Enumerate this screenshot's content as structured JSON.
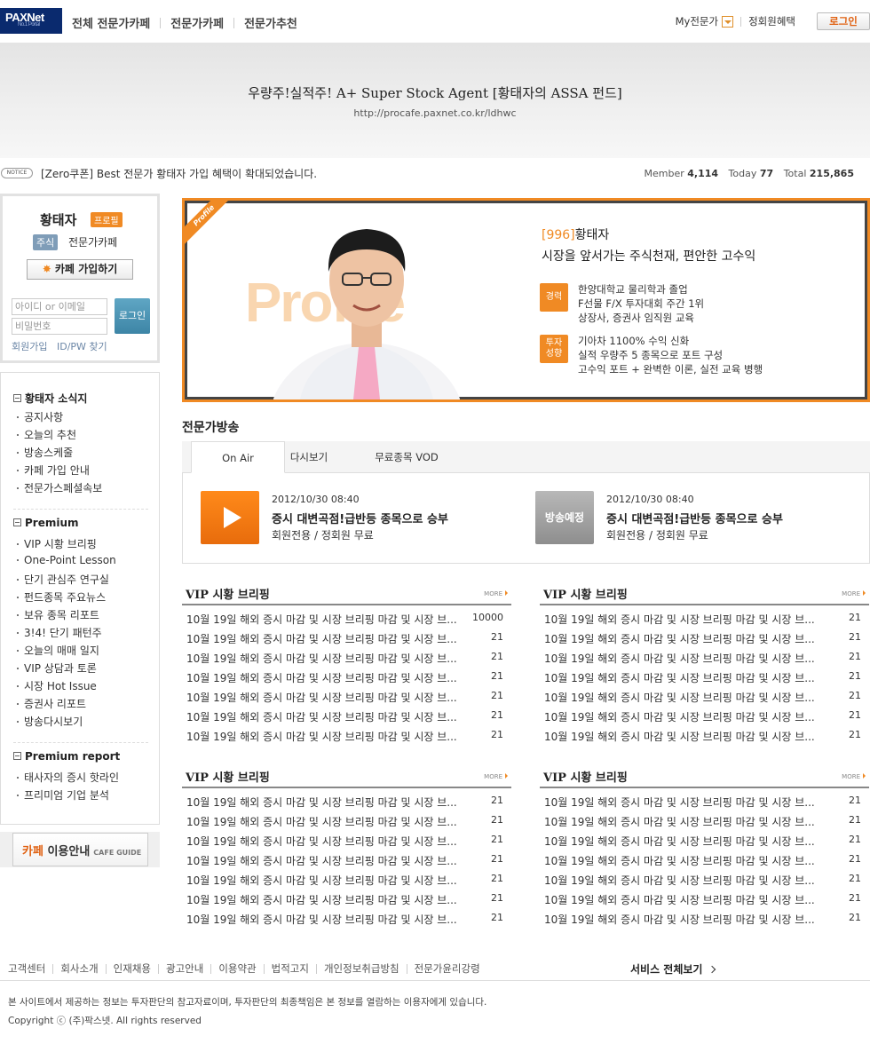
{
  "header": {
    "logo": "PAXNet",
    "logo_sub": "No.1 Portal",
    "nav": [
      "전체 전문가카페",
      "전문가카페",
      "전문가추천"
    ],
    "my_expert": "My전문가",
    "member_benefit": "정회원혜택",
    "login": "로그인"
  },
  "banner": {
    "title": "우량주!실적주! A+ Super Stock Agent [황태자의 ASSA 펀드]",
    "url": "http://procafe.paxnet.co.kr/ldhwc"
  },
  "notice": {
    "badge": "NOTICE",
    "text": "[Zero쿠폰] Best 전문가 황태자 가입 혜택이 확대되었습니다.",
    "member_label": "Member",
    "member": "4,114",
    "today_label": "Today",
    "today": "77",
    "total_label": "Total",
    "total": "215,865"
  },
  "sidebar": {
    "name": "황태자",
    "profile_tag": "프로필",
    "category": "주식",
    "cafe_type": "전문가카페",
    "join": "카페 가입하기",
    "id_placeholder": "아이디 or 이메일",
    "pw_placeholder": "비밀번호",
    "login": "로그인",
    "signup": "회원가입",
    "find": "ID/PW 찾기",
    "sections": [
      {
        "title": "황태자 소식지",
        "items": [
          "공지사항",
          "오늘의 추천",
          "방송스케줄",
          "카페 가입 안내",
          "전문가스페셜속보"
        ]
      },
      {
        "title": "Premium",
        "items": [
          "VIP 시황 브리핑",
          "One-Point Lesson",
          "단기 관심주 연구실",
          "펀드종목 주요뉴스",
          "보유 종목 리포트",
          "3!4! 단기 패턴주",
          "오늘의 매매 일지",
          "VIP 상담과 토론",
          "시장 Hot Issue",
          "증권사 리포트",
          "방송다시보기"
        ]
      },
      {
        "title": "Premium report",
        "items": [
          "태사자의 증시 핫라인",
          "프리미엄 기업 분석"
        ]
      }
    ],
    "guide_o": "카페",
    "guide": "이용안내",
    "guide_en": "CAFE GUIDE"
  },
  "profile": {
    "ribbon": "Profile",
    "bg_word": "Profile",
    "code": "[996]",
    "name": "황태자",
    "slogan": "시장을 앞서가는 주식천재, 편안한 고수익",
    "career_badge": "경력",
    "career": [
      "한양대학교 물리학과 졸업",
      "F선물 F/X 투자대회 주간 1위",
      "상장사, 증권사 임직원 교육"
    ],
    "style_badge": "투자성향",
    "style": [
      "기아차 1100% 수익 신화",
      "실적 우량주 5 종목으로 포트 구성",
      "고수익 포트 + 완벽한 이론, 실전 교육 병행"
    ]
  },
  "broadcast": {
    "title": "전문가방송",
    "tabs": [
      "On Air",
      "다시보기",
      "무료종목 VOD"
    ],
    "items": [
      {
        "date": "2012/10/30 08:40",
        "title": "증시 대변곡점!급반등 종목으로 승부",
        "sub": "회원전용 / 정회원 무료"
      },
      {
        "date": "2012/10/30 08:40",
        "title": "증시 대변곡점!급반등 종목으로 승부",
        "sub": "회원전용 / 정회원 무료",
        "badge": "방송예정"
      }
    ]
  },
  "vip_boards": [
    {
      "title": "VIP 시황 브리핑",
      "more": "MORE",
      "rows": [
        {
          "t": "10월 19일 해외 증시 마감 및 시장 브리핑 마감 및 시장 브...",
          "n": "10000"
        },
        {
          "t": "10월 19일 해외 증시 마감 및 시장 브리핑 마감 및 시장 브...",
          "n": "21"
        },
        {
          "t": "10월 19일 해외 증시 마감 및 시장 브리핑 마감 및 시장 브...",
          "n": "21"
        },
        {
          "t": "10월 19일 해외 증시 마감 및 시장 브리핑 마감 및 시장 브...",
          "n": "21"
        },
        {
          "t": "10월 19일 해외 증시 마감 및 시장 브리핑 마감 및 시장 브...",
          "n": "21"
        },
        {
          "t": "10월 19일 해외 증시 마감 및 시장 브리핑 마감 및 시장 브...",
          "n": "21"
        },
        {
          "t": "10월 19일 해외 증시 마감 및 시장 브리핑 마감 및 시장 브...",
          "n": "21"
        }
      ]
    },
    {
      "title": "VIP 시황 브리핑",
      "more": "MORE",
      "rows": [
        {
          "t": "10월 19일 해외 증시 마감 및 시장 브리핑 마감 및 시장 브...",
          "n": "21"
        },
        {
          "t": "10월 19일 해외 증시 마감 및 시장 브리핑 마감 및 시장 브...",
          "n": "21"
        },
        {
          "t": "10월 19일 해외 증시 마감 및 시장 브리핑 마감 및 시장 브...",
          "n": "21"
        },
        {
          "t": "10월 19일 해외 증시 마감 및 시장 브리핑 마감 및 시장 브...",
          "n": "21"
        },
        {
          "t": "10월 19일 해외 증시 마감 및 시장 브리핑 마감 및 시장 브...",
          "n": "21"
        },
        {
          "t": "10월 19일 해외 증시 마감 및 시장 브리핑 마감 및 시장 브...",
          "n": "21"
        },
        {
          "t": "10월 19일 해외 증시 마감 및 시장 브리핑 마감 및 시장 브...",
          "n": "21"
        }
      ]
    },
    {
      "title": "VIP 시황 브리핑",
      "more": "MORE",
      "rows": [
        {
          "t": "10월 19일 해외 증시 마감 및 시장 브리핑 마감 및 시장 브...",
          "n": "21"
        },
        {
          "t": "10월 19일 해외 증시 마감 및 시장 브리핑 마감 및 시장 브...",
          "n": "21"
        },
        {
          "t": "10월 19일 해외 증시 마감 및 시장 브리핑 마감 및 시장 브...",
          "n": "21"
        },
        {
          "t": "10월 19일 해외 증시 마감 및 시장 브리핑 마감 및 시장 브...",
          "n": "21"
        },
        {
          "t": "10월 19일 해외 증시 마감 및 시장 브리핑 마감 및 시장 브...",
          "n": "21"
        },
        {
          "t": "10월 19일 해외 증시 마감 및 시장 브리핑 마감 및 시장 브...",
          "n": "21"
        },
        {
          "t": "10월 19일 해외 증시 마감 및 시장 브리핑 마감 및 시장 브...",
          "n": "21"
        }
      ]
    },
    {
      "title": "VIP 시황 브리핑",
      "more": "MORE",
      "rows": [
        {
          "t": "10월 19일 해외 증시 마감 및 시장 브리핑 마감 및 시장 브...",
          "n": "21"
        },
        {
          "t": "10월 19일 해외 증시 마감 및 시장 브리핑 마감 및 시장 브...",
          "n": "21"
        },
        {
          "t": "10월 19일 해외 증시 마감 및 시장 브리핑 마감 및 시장 브...",
          "n": "21"
        },
        {
          "t": "10월 19일 해외 증시 마감 및 시장 브리핑 마감 및 시장 브...",
          "n": "21"
        },
        {
          "t": "10월 19일 해외 증시 마감 및 시장 브리핑 마감 및 시장 브...",
          "n": "21"
        },
        {
          "t": "10월 19일 해외 증시 마감 및 시장 브리핑 마감 및 시장 브...",
          "n": "21"
        },
        {
          "t": "10월 19일 해외 증시 마감 및 시장 브리핑 마감 및 시장 브...",
          "n": "21"
        }
      ]
    }
  ],
  "footer": {
    "links": [
      "고객센터",
      "회사소개",
      "인재채용",
      "광고안내",
      "이용약관",
      "법적고지",
      "개인정보취급방침",
      "전문가윤리강령"
    ],
    "all_services": "서비스 전체보기",
    "disclaimer": "본 사이트에서 제공하는 정보는 투자판단의 참고자료이며, 투자판단의 최종책임은 본 정보를 열람하는 이용자에게 있습니다.",
    "copyright": "Copyright ⓒ (주)팍스넷. All rights reserved"
  },
  "colors": {
    "accent": "#f08a24",
    "navy": "#0a2a6e",
    "login_blue": "#4a92b3"
  }
}
